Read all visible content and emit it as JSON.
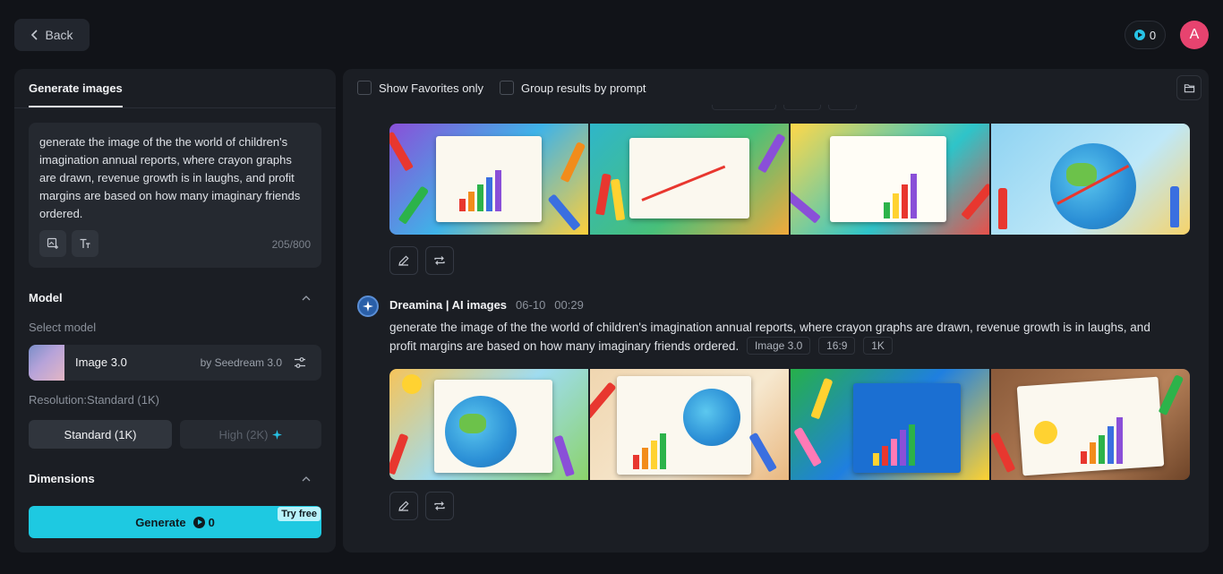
{
  "topbar": {
    "back_label": "Back",
    "credits": "0",
    "avatar_initial": "A"
  },
  "left_panel": {
    "tab_label": "Generate images",
    "prompt_text": "generate the image of the the world of children's imagination annual reports, where crayon graphs are drawn, revenue growth is in laughs, and profit margins are based on how many imaginary friends ordered.",
    "char_count": "205/800",
    "model_section_title": "Model",
    "select_model_label": "Select model",
    "model_name": "Image 3.0",
    "model_by": "by Seedream 3.0",
    "resolution_label": "Resolution:Standard (1K)",
    "res_standard": "Standard (1K)",
    "res_high": "High (2K)",
    "dimensions_title": "Dimensions",
    "generate_label": "Generate",
    "generate_cost": "0",
    "try_free": "Try free"
  },
  "right_panel": {
    "show_favorites": "Show Favorites only",
    "group_by_prompt": "Group results by prompt",
    "generation": {
      "source": "Dreamina | AI images",
      "date": "06-10",
      "time": "00:29",
      "prompt": "generate the image of the the world of children's imagination annual reports, where crayon graphs are drawn, revenue growth is in laughs, and profit margins are based on how many imaginary friends ordered.",
      "tags": [
        "Image 3.0",
        "16:9",
        "1K"
      ]
    }
  },
  "colors": {
    "accent": "#1ec9e1",
    "avatar": "#e7436f",
    "background": "#111318",
    "panel": "#1b1e24"
  },
  "icons": {
    "back": "chevron-left-icon",
    "credits": "play-coin-icon",
    "folder": "folder-icon",
    "edit": "pencil-icon",
    "regenerate": "repeat-icon",
    "image_ref": "image-add-icon",
    "text_tool": "text-size-icon",
    "model_settings": "sliders-icon",
    "sparkle": "sparkle-icon",
    "collapse": "chevron-up-icon"
  }
}
